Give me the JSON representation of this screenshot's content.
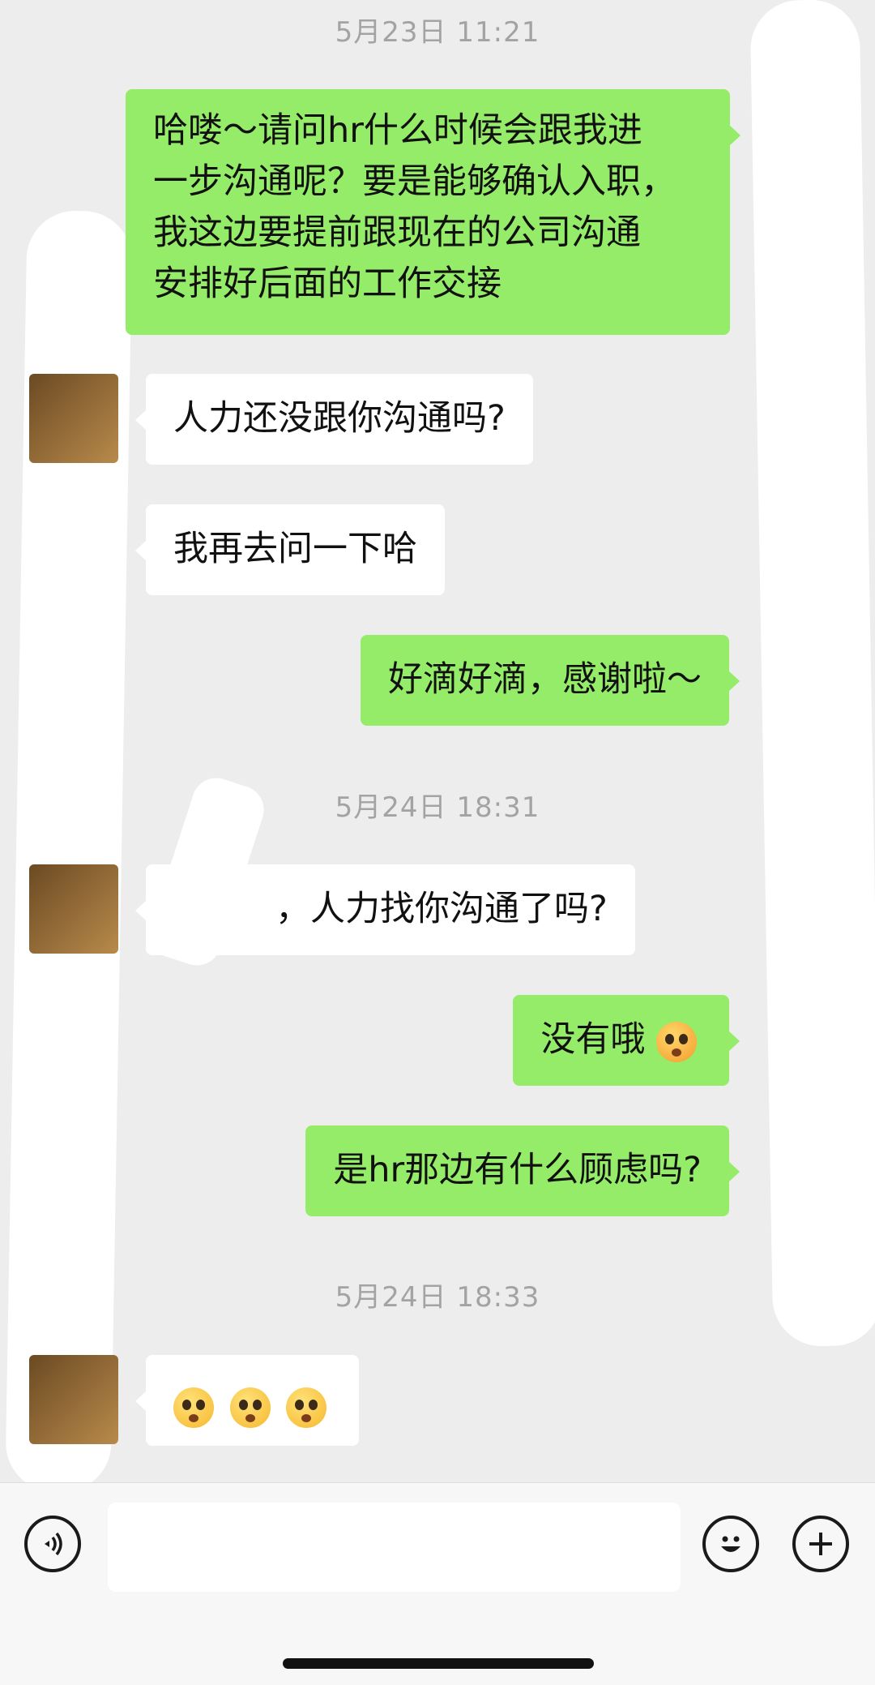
{
  "messages": [
    {
      "type": "timestamp",
      "text": "5月23日 11:21"
    },
    {
      "type": "sent",
      "lines": [
        "哈喽～请问hr什么时候会跟我进",
        "一步沟通呢？要是能够确认入职，",
        "我这边要提前跟现在的公司沟通",
        "安排好后面的工作交接"
      ]
    },
    {
      "type": "received",
      "text": "人力还没跟你沟通吗?"
    },
    {
      "type": "received",
      "text": "我再去问一下哈"
    },
    {
      "type": "sent",
      "text": "好滴好滴，感谢啦～"
    },
    {
      "type": "timestamp",
      "text": "5月24日 18:31"
    },
    {
      "type": "received",
      "text": "，人力找你沟通了吗?"
    },
    {
      "type": "sent",
      "text": "没有哦"
    },
    {
      "type": "sent",
      "text": "是hr那边有什么顾虑吗?"
    },
    {
      "type": "timestamp",
      "text": "5月24日 18:33"
    },
    {
      "type": "received",
      "emoji": [
        "flushed-face-emoji",
        "flushed-face-emoji",
        "flushed-face-emoji"
      ]
    }
  ],
  "input_bar": {
    "message_value": "",
    "icons": [
      "voice-icon",
      "emoji-icon",
      "plus-icon"
    ]
  },
  "colors": {
    "background": "#ededed",
    "sent_bubble": "#95ec69",
    "received_bubble": "#ffffff",
    "timestamp_text": "#a3a3a3"
  }
}
